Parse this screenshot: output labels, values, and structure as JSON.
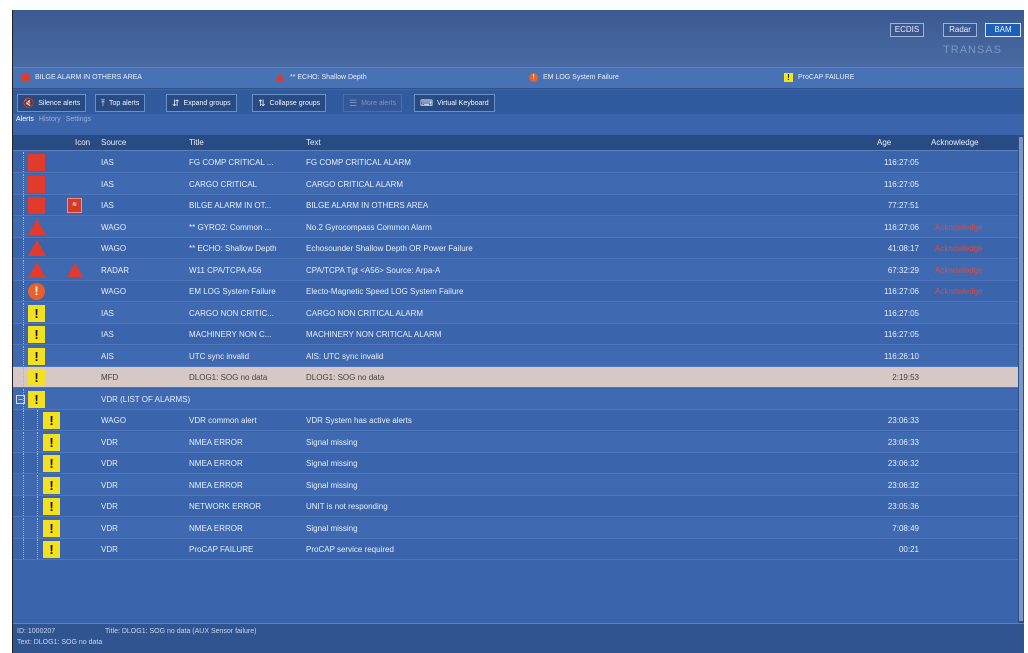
{
  "modes": [
    {
      "label": "ECDIS",
      "active": false
    },
    {
      "label": "Radar",
      "active": false
    },
    {
      "label": "BAM",
      "active": true
    }
  ],
  "brand": "TRANSAS",
  "alert_bar": [
    {
      "icon": "red-square-icon",
      "text": "BILGE ALARM IN OTHERS AREA"
    },
    {
      "icon": "red-triangle-icon",
      "text": "** ECHO: Shallow Depth"
    },
    {
      "icon": "orange-circle-icon",
      "text": "EM LOG System Failure"
    },
    {
      "icon": "yellow-square-icon",
      "text": "ProCAP FAILURE"
    }
  ],
  "toolbar": {
    "silence": "Silence alerts",
    "top": "Top alerts",
    "expand": "Expand groups",
    "collapse": "Collapse groups",
    "more": "More alerts",
    "keyboard": "Virtual Keyboard"
  },
  "tabs": [
    "Alerts",
    "History",
    "Settings"
  ],
  "columns": {
    "icon": "Icon",
    "source": "Source",
    "title": "Title",
    "text": "Text",
    "age": "Age",
    "ack": "Acknowledge"
  },
  "rows": [
    {
      "prio": "red",
      "src": "IAS",
      "title": "FG COMP CRITICAL ...",
      "text": "FG COMP CRITICAL ALARM",
      "age": "116:27:05",
      "ack": ""
    },
    {
      "prio": "red",
      "src": "IAS",
      "title": "CARGO CRITICAL",
      "text": "CARGO CRITICAL ALARM",
      "age": "116:27:05",
      "ack": ""
    },
    {
      "prio": "red",
      "src": "IAS",
      "title": "BILGE ALARM IN OT...",
      "text": "BILGE ALARM IN OTHERS AREA",
      "age": "77:27:51",
      "ack": ""
    },
    {
      "prio": "tri",
      "src": "WAGO",
      "title": "** GYRO2: Common ...",
      "text": "No.2 Gyrocompass Common Alarm",
      "age": "116:27:06",
      "ack": "Acknowledge"
    },
    {
      "prio": "tri",
      "src": "WAGO",
      "title": "** ECHO: Shallow Depth",
      "text": "Echosounder Shallow Depth OR Power Failure",
      "age": "41:08:17",
      "ack": "Acknowledge"
    },
    {
      "prio": "tri",
      "src": "RADAR",
      "title": "W11 CPA/TCPA A56",
      "text": "CPA/TCPA Tgt <A56> Source: Arpa-A",
      "age": "67:32:29",
      "ack": "Acknowledge"
    },
    {
      "prio": "circ",
      "src": "WAGO",
      "title": "EM LOG System Failure",
      "text": "Electo-Magnetic Speed LOG System Failure",
      "age": "116:27:06",
      "ack": "Acknowledge"
    },
    {
      "prio": "yellow",
      "src": "IAS",
      "title": "CARGO NON CRITIC...",
      "text": "CARGO NON CRITICAL ALARM",
      "age": "116:27:05",
      "ack": ""
    },
    {
      "prio": "yellow",
      "src": "IAS",
      "title": "MACHINERY NON C...",
      "text": "MACHINERY NON CRITICAL ALARM",
      "age": "116:27:05",
      "ack": ""
    },
    {
      "prio": "yellow",
      "src": "AIS",
      "title": "UTC sync invalid",
      "text": "AIS: UTC sync invalid",
      "age": "116:26:10",
      "ack": ""
    },
    {
      "prio": "yellow",
      "src": "MFD",
      "title": "DLOG1: SOG no data",
      "text": "DLOG1: SOG no data",
      "age": "2:19:53",
      "ack": ""
    },
    {
      "prio": "yellow",
      "src": "VDR (LIST OF ALARMS)",
      "title": "",
      "text": "",
      "age": "",
      "ack": ""
    },
    {
      "prio": "yellow",
      "src": "WAGO",
      "title": "VDR common alert",
      "text": "VDR System has active alerts",
      "age": "23:06:33",
      "ack": ""
    },
    {
      "prio": "yellow",
      "src": "VDR",
      "title": "NMEA ERROR",
      "text": "Signal missing",
      "age": "23:06:33",
      "ack": ""
    },
    {
      "prio": "yellow",
      "src": "VDR",
      "title": "NMEA ERROR",
      "text": "Signal missing",
      "age": "23:06:32",
      "ack": ""
    },
    {
      "prio": "yellow",
      "src": "VDR",
      "title": "NMEA ERROR",
      "text": "Signal missing",
      "age": "23:06:32",
      "ack": ""
    },
    {
      "prio": "yellow",
      "src": "VDR",
      "title": "NETWORK ERROR",
      "text": "UNIT is not responding",
      "age": "23:05:36",
      "ack": ""
    },
    {
      "prio": "yellow",
      "src": "VDR",
      "title": "NMEA ERROR",
      "text": "Signal missing",
      "age": "7:08:49",
      "ack": ""
    },
    {
      "prio": "yellow",
      "src": "VDR",
      "title": "ProCAP FAILURE",
      "text": "ProCAP service required",
      "age": "00:21",
      "ack": ""
    }
  ],
  "footer": {
    "id": "ID: 1000207",
    "title": "Title: DLOG1: SOG no data (AUX Sensor failure)",
    "text": "Text: DLOG1: SOG no data"
  },
  "colors": {
    "background": "#3a65ad",
    "alarm_red": "#e23a2b",
    "caution_yellow": "#f3e01e",
    "warning_orange": "#e8612a",
    "selected_row": "#d6c8c6",
    "acknowledge_text": "#e2483a"
  }
}
